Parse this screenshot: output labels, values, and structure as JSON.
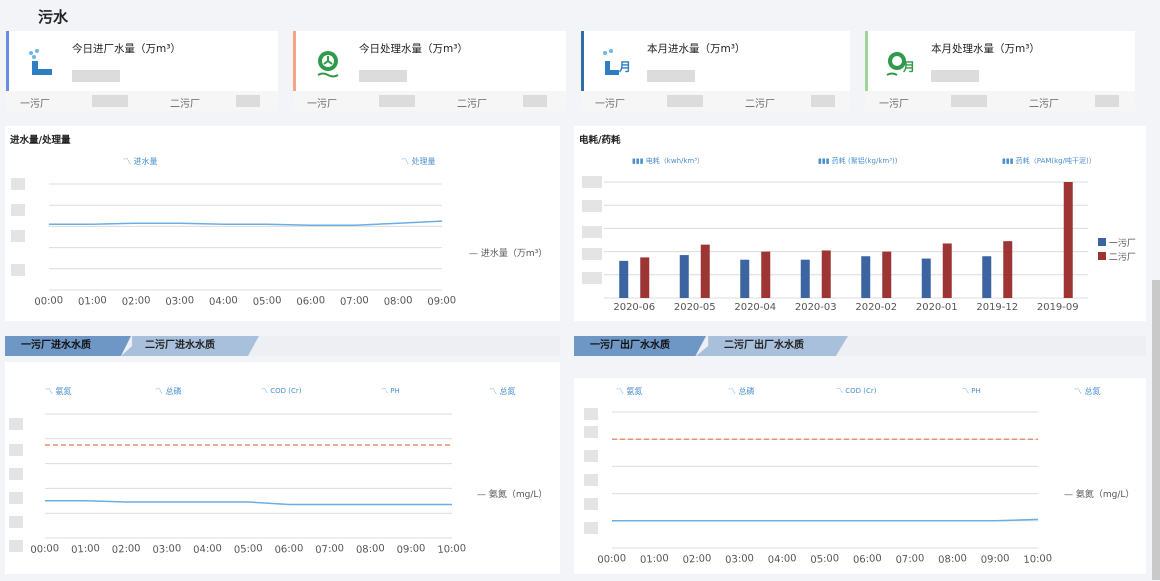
{
  "page_title": "污水",
  "cards": [
    {
      "title": "今日进厂水量（万m³）",
      "plant1": "一污厂",
      "plant2": "二污厂",
      "accent": "#6a8de0",
      "icon": "water-tap-icon"
    },
    {
      "title": "今日处理水量（万m³）",
      "plant1": "一污厂",
      "plant2": "二污厂",
      "accent": "#f2a58a",
      "icon": "treatment-fan-icon"
    },
    {
      "title": "本月进水量（万m³）",
      "plant1": "一污厂",
      "plant2": "二污厂",
      "accent": "#2d6ea8",
      "icon": "monthly-tap-icon"
    },
    {
      "title": "本月处理水量（万m³）",
      "plant1": "一污厂",
      "plant2": "二污厂",
      "accent": "#9fd59a",
      "icon": "monthly-treatment-icon"
    }
  ],
  "panels": {
    "water": {
      "title": "进水量/处理量",
      "legend": [
        "进水量",
        "处理量"
      ],
      "series_label": "进水量（万m³）"
    },
    "energy": {
      "title": "电耗/药耗",
      "legend": [
        "电耗（kwh/km³）",
        "药耗 (絮铝(kg/km³))",
        "药耗（PAM(kg/吨干泥)）"
      ],
      "series": [
        "一污厂",
        "二污厂"
      ]
    },
    "inflow_quality": {
      "tabs": [
        "一污厂进水水质",
        "二污厂进水水质"
      ],
      "legend": [
        "氨氮",
        "总磷",
        "COD (Cr)",
        "PH",
        "总氮"
      ],
      "series_label": "氨氮（mg/L）"
    },
    "outflow_quality": {
      "tabs": [
        "一污厂出厂水水质",
        "二污厂出厂水水质"
      ],
      "legend": [
        "氨氮",
        "总磷",
        "COD (Cr)",
        "PH",
        "总氮"
      ],
      "series_label": "氨氮（mg/L）"
    }
  },
  "chart_data": [
    {
      "type": "line",
      "title": "进水量/处理量",
      "x": [
        "00:00",
        "01:00",
        "02:00",
        "03:00",
        "04:00",
        "05:00",
        "06:00",
        "07:00",
        "08:00",
        "09:00"
      ],
      "series": [
        {
          "name": "进水量（万m³）",
          "values": [
            0.62,
            0.62,
            0.63,
            0.63,
            0.62,
            0.62,
            0.61,
            0.61,
            0.63,
            0.65
          ]
        }
      ],
      "ylim": [
        0,
        1
      ],
      "color": "#6aaee6"
    },
    {
      "type": "bar",
      "title": "电耗/药耗",
      "categories": [
        "2020-06",
        "2020-05",
        "2020-04",
        "2020-03",
        "2020-02",
        "2020-01",
        "2019-12",
        "2019-09"
      ],
      "series": [
        {
          "name": "一污厂",
          "values": [
            32,
            37,
            33,
            33,
            36,
            34,
            36,
            0
          ],
          "color": "#3c64a0"
        },
        {
          "name": "二污厂",
          "values": [
            35,
            46,
            40,
            41,
            40,
            47,
            49,
            100
          ],
          "color": "#9e3535"
        }
      ],
      "ylim": [
        0,
        100
      ]
    },
    {
      "type": "line",
      "title": "一污厂进水水质",
      "x": [
        "00:00",
        "01:00",
        "02:00",
        "03:00",
        "04:00",
        "05:00",
        "06:00",
        "07:00",
        "08:00",
        "09:00",
        "10:00"
      ],
      "series": [
        {
          "name": "氨氮（mg/L）",
          "values": [
            0.3,
            0.3,
            0.29,
            0.29,
            0.29,
            0.29,
            0.27,
            0.27,
            0.27,
            0.27,
            0.27
          ]
        }
      ],
      "threshold": 0.75,
      "ylim": [
        0,
        1
      ],
      "color": "#6aaee6"
    },
    {
      "type": "line",
      "title": "一污厂出厂水水质",
      "x": [
        "00:00",
        "01:00",
        "02:00",
        "03:00",
        "04:00",
        "05:00",
        "06:00",
        "07:00",
        "08:00",
        "09:00",
        "10:00"
      ],
      "series": [
        {
          "name": "氨氮（mg/L）",
          "values": [
            0.2,
            0.2,
            0.2,
            0.2,
            0.2,
            0.2,
            0.2,
            0.2,
            0.2,
            0.2,
            0.21
          ]
        }
      ],
      "threshold": 0.8,
      "ylim": [
        0,
        1
      ],
      "color": "#6aaee6"
    }
  ]
}
